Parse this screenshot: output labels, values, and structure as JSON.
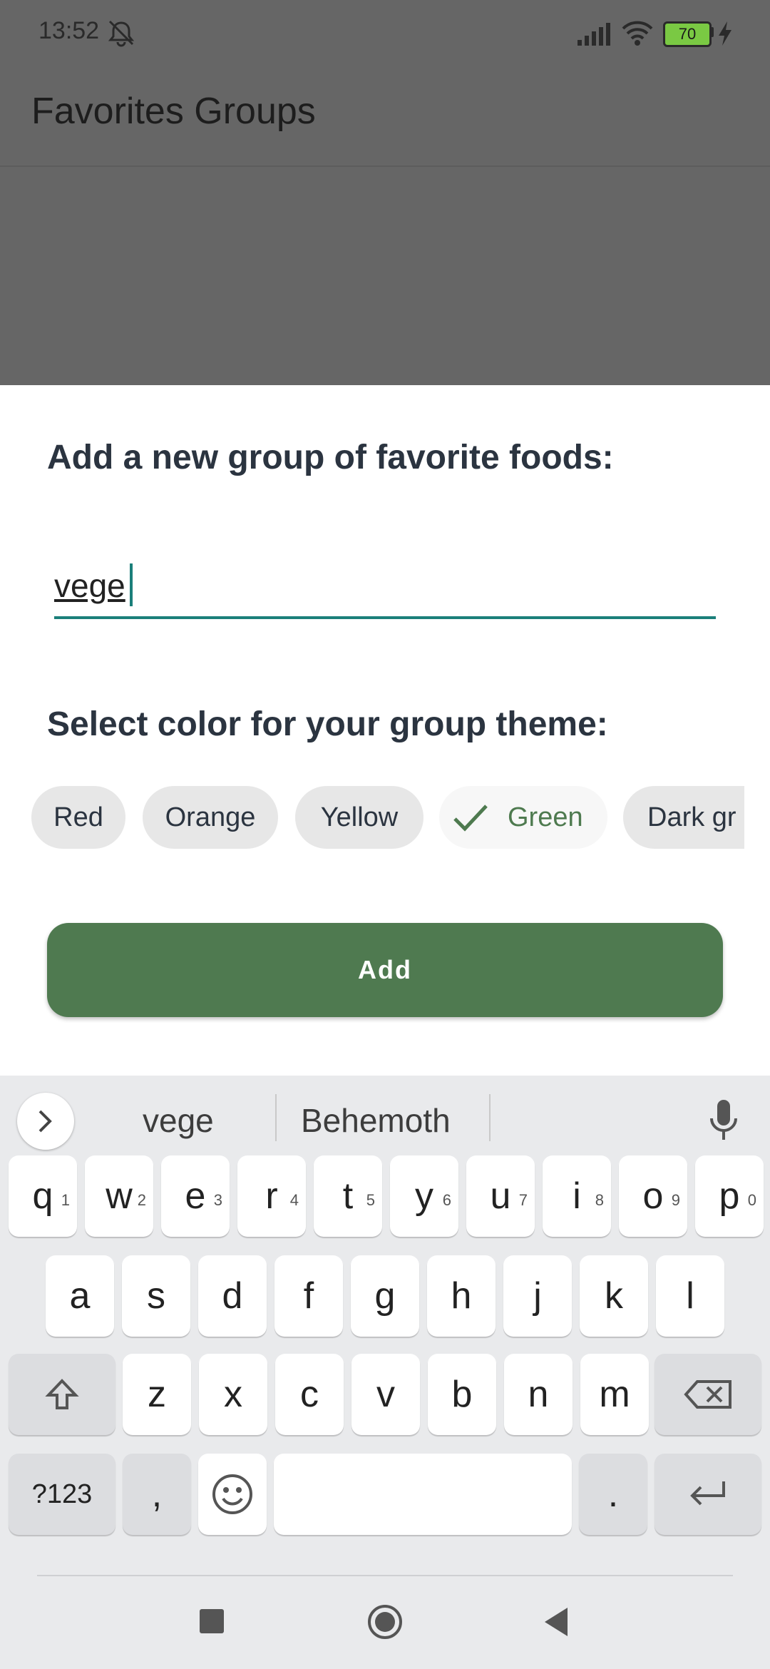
{
  "status_bar": {
    "time": "13:52",
    "battery": "70"
  },
  "app_bar": {
    "title": "Favorites Groups"
  },
  "dialog": {
    "heading_name": "Add a new group of favorite foods:",
    "name_input_value": "vege",
    "heading_color": "Select color for your group theme:",
    "color_chips": [
      {
        "label": "Red",
        "selected": false
      },
      {
        "label": "Orange",
        "selected": false
      },
      {
        "label": "Yellow",
        "selected": false
      },
      {
        "label": "Green",
        "selected": true
      },
      {
        "label": "Dark gr",
        "selected": false
      }
    ],
    "add_label": "Add"
  },
  "keyboard": {
    "suggestions": [
      "vege",
      "Behemoth"
    ],
    "row1": [
      {
        "key": "q",
        "hint": "1"
      },
      {
        "key": "w",
        "hint": "2"
      },
      {
        "key": "e",
        "hint": "3"
      },
      {
        "key": "r",
        "hint": "4"
      },
      {
        "key": "t",
        "hint": "5"
      },
      {
        "key": "y",
        "hint": "6"
      },
      {
        "key": "u",
        "hint": "7"
      },
      {
        "key": "i",
        "hint": "8"
      },
      {
        "key": "o",
        "hint": "9"
      },
      {
        "key": "p",
        "hint": "0"
      }
    ],
    "row2": [
      "a",
      "s",
      "d",
      "f",
      "g",
      "h",
      "j",
      "k",
      "l"
    ],
    "row3": [
      "z",
      "x",
      "c",
      "v",
      "b",
      "n",
      "m"
    ],
    "row4": {
      "symbols": "?123",
      "comma": ",",
      "period": "."
    }
  },
  "colors": {
    "accent_teal": "#1b7f7a",
    "button_green": "#4f7a50",
    "chip_selected_text": "#4e7a4f"
  }
}
